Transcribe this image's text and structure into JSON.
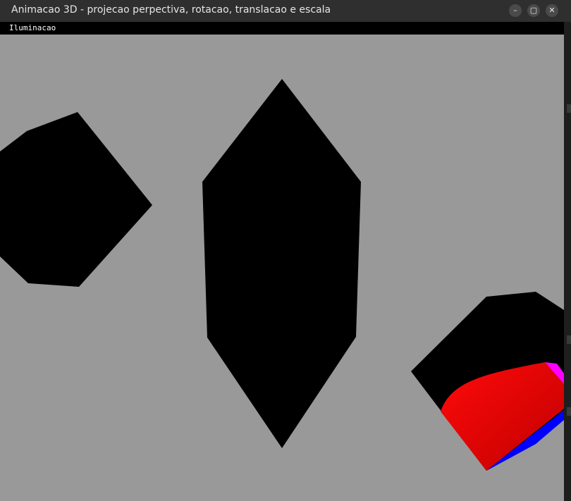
{
  "window": {
    "title": "Animacao 3D - projecao perpectiva, rotacao, translacao e escala",
    "minimize_glyph": "–",
    "maximize_glyph": "▢",
    "close_glyph": "✕"
  },
  "menu": {
    "items": [
      "Iluminacao"
    ]
  },
  "scene": {
    "background": "#999999",
    "shape_color": "#000000",
    "lit_face_color": "#ff0000",
    "lit_face_shade": "#c40000",
    "edge_blue": "#0000ff",
    "edge_magenta": "#ff00ff"
  }
}
